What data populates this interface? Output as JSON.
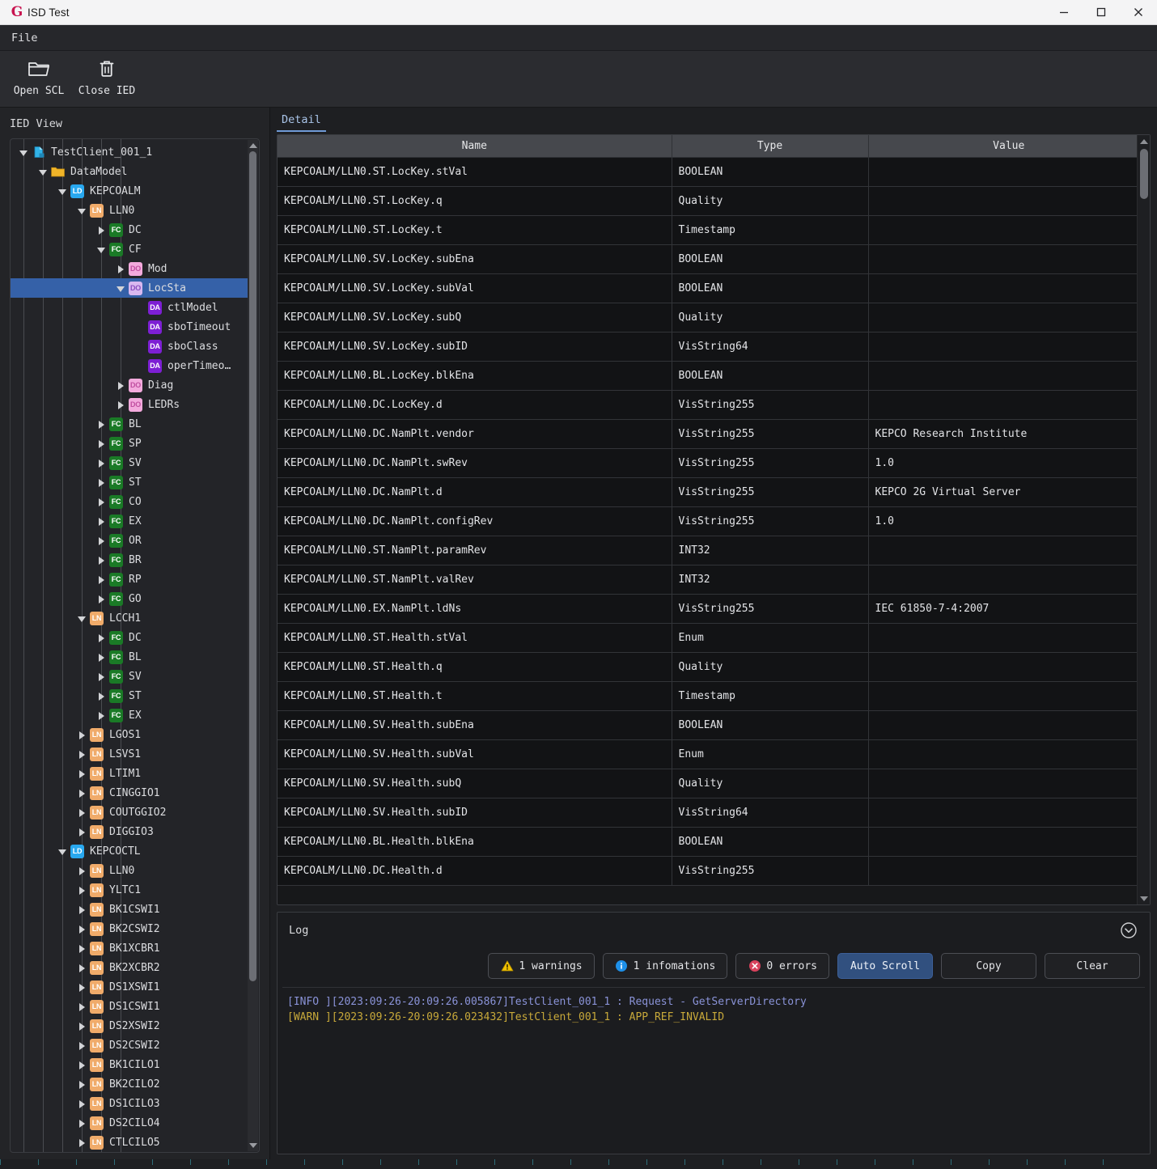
{
  "window": {
    "title": "ISD Test",
    "logo_glyph": "G",
    "minimize": "─",
    "maximize": "□",
    "close": "✕"
  },
  "menubar": {
    "items": [
      {
        "label": "File"
      }
    ]
  },
  "toolbar": {
    "buttons": [
      {
        "label": "Open SCL",
        "icon": "folder-open-icon"
      },
      {
        "label": "Close IED",
        "icon": "trash-icon"
      }
    ]
  },
  "left_pane": {
    "title": "IED View",
    "tree": [
      {
        "depth": 0,
        "arrow": "open",
        "badge": "file",
        "badge_text": "",
        "label": "TestClient_001_1",
        "selected": false
      },
      {
        "depth": 1,
        "arrow": "open",
        "badge": "folder",
        "badge_text": "",
        "label": "DataModel",
        "selected": false
      },
      {
        "depth": 2,
        "arrow": "open",
        "badge": "LD",
        "badge_text": "LD",
        "label": "KEPCOALM",
        "selected": false
      },
      {
        "depth": 3,
        "arrow": "open",
        "badge": "LN",
        "badge_text": "LN",
        "label": "LLN0",
        "selected": false
      },
      {
        "depth": 4,
        "arrow": "closed",
        "badge": "FC",
        "badge_text": "FC",
        "label": "DC",
        "selected": false
      },
      {
        "depth": 4,
        "arrow": "open",
        "badge": "FC",
        "badge_text": "FC",
        "label": "CF",
        "selected": false
      },
      {
        "depth": 5,
        "arrow": "closed",
        "badge": "DO",
        "badge_text": "DO",
        "label": "Mod",
        "selected": false
      },
      {
        "depth": 5,
        "arrow": "open",
        "badge": "DOa",
        "badge_text": "DO",
        "label": "LocSta",
        "selected": true
      },
      {
        "depth": 6,
        "arrow": "none",
        "badge": "DA",
        "badge_text": "DA",
        "label": "ctlModel",
        "selected": false
      },
      {
        "depth": 6,
        "arrow": "none",
        "badge": "DA",
        "badge_text": "DA",
        "label": "sboTimeout",
        "selected": false
      },
      {
        "depth": 6,
        "arrow": "none",
        "badge": "DA",
        "badge_text": "DA",
        "label": "sboClass",
        "selected": false
      },
      {
        "depth": 6,
        "arrow": "none",
        "badge": "DA",
        "badge_text": "DA",
        "label": "operTimeo…",
        "selected": false
      },
      {
        "depth": 5,
        "arrow": "closed",
        "badge": "DO",
        "badge_text": "DO",
        "label": "Diag",
        "selected": false
      },
      {
        "depth": 5,
        "arrow": "closed",
        "badge": "DO",
        "badge_text": "DO",
        "label": "LEDRs",
        "selected": false
      },
      {
        "depth": 4,
        "arrow": "closed",
        "badge": "FC",
        "badge_text": "FC",
        "label": "BL",
        "selected": false
      },
      {
        "depth": 4,
        "arrow": "closed",
        "badge": "FC",
        "badge_text": "FC",
        "label": "SP",
        "selected": false
      },
      {
        "depth": 4,
        "arrow": "closed",
        "badge": "FC",
        "badge_text": "FC",
        "label": "SV",
        "selected": false
      },
      {
        "depth": 4,
        "arrow": "closed",
        "badge": "FC",
        "badge_text": "FC",
        "label": "ST",
        "selected": false
      },
      {
        "depth": 4,
        "arrow": "closed",
        "badge": "FC",
        "badge_text": "FC",
        "label": "CO",
        "selected": false
      },
      {
        "depth": 4,
        "arrow": "closed",
        "badge": "FC",
        "badge_text": "FC",
        "label": "EX",
        "selected": false
      },
      {
        "depth": 4,
        "arrow": "closed",
        "badge": "FC",
        "badge_text": "FC",
        "label": "OR",
        "selected": false
      },
      {
        "depth": 4,
        "arrow": "closed",
        "badge": "FC",
        "badge_text": "FC",
        "label": "BR",
        "selected": false
      },
      {
        "depth": 4,
        "arrow": "closed",
        "badge": "FC",
        "badge_text": "FC",
        "label": "RP",
        "selected": false
      },
      {
        "depth": 4,
        "arrow": "closed",
        "badge": "FC",
        "badge_text": "FC",
        "label": "GO",
        "selected": false
      },
      {
        "depth": 3,
        "arrow": "open",
        "badge": "LN",
        "badge_text": "LN",
        "label": "LCCH1",
        "selected": false
      },
      {
        "depth": 4,
        "arrow": "closed",
        "badge": "FC",
        "badge_text": "FC",
        "label": "DC",
        "selected": false
      },
      {
        "depth": 4,
        "arrow": "closed",
        "badge": "FC",
        "badge_text": "FC",
        "label": "BL",
        "selected": false
      },
      {
        "depth": 4,
        "arrow": "closed",
        "badge": "FC",
        "badge_text": "FC",
        "label": "SV",
        "selected": false
      },
      {
        "depth": 4,
        "arrow": "closed",
        "badge": "FC",
        "badge_text": "FC",
        "label": "ST",
        "selected": false
      },
      {
        "depth": 4,
        "arrow": "closed",
        "badge": "FC",
        "badge_text": "FC",
        "label": "EX",
        "selected": false
      },
      {
        "depth": 3,
        "arrow": "closed",
        "badge": "LN",
        "badge_text": "LN",
        "label": "LGOS1",
        "selected": false
      },
      {
        "depth": 3,
        "arrow": "closed",
        "badge": "LN",
        "badge_text": "LN",
        "label": "LSVS1",
        "selected": false
      },
      {
        "depth": 3,
        "arrow": "closed",
        "badge": "LN",
        "badge_text": "LN",
        "label": "LTIM1",
        "selected": false
      },
      {
        "depth": 3,
        "arrow": "closed",
        "badge": "LN",
        "badge_text": "LN",
        "label": "CINGGIO1",
        "selected": false
      },
      {
        "depth": 3,
        "arrow": "closed",
        "badge": "LN",
        "badge_text": "LN",
        "label": "COUTGGIO2",
        "selected": false
      },
      {
        "depth": 3,
        "arrow": "closed",
        "badge": "LN",
        "badge_text": "LN",
        "label": "DIGGIO3",
        "selected": false
      },
      {
        "depth": 2,
        "arrow": "open",
        "badge": "LD",
        "badge_text": "LD",
        "label": "KEPCOCTL",
        "selected": false
      },
      {
        "depth": 3,
        "arrow": "closed",
        "badge": "LN",
        "badge_text": "LN",
        "label": "LLN0",
        "selected": false
      },
      {
        "depth": 3,
        "arrow": "closed",
        "badge": "LN",
        "badge_text": "LN",
        "label": "YLTC1",
        "selected": false
      },
      {
        "depth": 3,
        "arrow": "closed",
        "badge": "LN",
        "badge_text": "LN",
        "label": "BK1CSWI1",
        "selected": false
      },
      {
        "depth": 3,
        "arrow": "closed",
        "badge": "LN",
        "badge_text": "LN",
        "label": "BK2CSWI2",
        "selected": false
      },
      {
        "depth": 3,
        "arrow": "closed",
        "badge": "LN",
        "badge_text": "LN",
        "label": "BK1XCBR1",
        "selected": false
      },
      {
        "depth": 3,
        "arrow": "closed",
        "badge": "LN",
        "badge_text": "LN",
        "label": "BK2XCBR2",
        "selected": false
      },
      {
        "depth": 3,
        "arrow": "closed",
        "badge": "LN",
        "badge_text": "LN",
        "label": "DS1XSWI1",
        "selected": false
      },
      {
        "depth": 3,
        "arrow": "closed",
        "badge": "LN",
        "badge_text": "LN",
        "label": "DS1CSWI1",
        "selected": false
      },
      {
        "depth": 3,
        "arrow": "closed",
        "badge": "LN",
        "badge_text": "LN",
        "label": "DS2XSWI2",
        "selected": false
      },
      {
        "depth": 3,
        "arrow": "closed",
        "badge": "LN",
        "badge_text": "LN",
        "label": "DS2CSWI2",
        "selected": false
      },
      {
        "depth": 3,
        "arrow": "closed",
        "badge": "LN",
        "badge_text": "LN",
        "label": "BK1CILO1",
        "selected": false
      },
      {
        "depth": 3,
        "arrow": "closed",
        "badge": "LN",
        "badge_text": "LN",
        "label": "BK2CILO2",
        "selected": false
      },
      {
        "depth": 3,
        "arrow": "closed",
        "badge": "LN",
        "badge_text": "LN",
        "label": "DS1CILO3",
        "selected": false
      },
      {
        "depth": 3,
        "arrow": "closed",
        "badge": "LN",
        "badge_text": "LN",
        "label": "DS2CILO4",
        "selected": false
      },
      {
        "depth": 3,
        "arrow": "closed",
        "badge": "LN",
        "badge_text": "LN",
        "label": "CTLCILO5",
        "selected": false
      }
    ]
  },
  "detail": {
    "tab_label": "Detail",
    "columns": [
      "Name",
      "Type",
      "Value"
    ],
    "rows": [
      {
        "name": "KEPCOALM/LLN0.ST.LocKey.stVal",
        "type": "BOOLEAN",
        "value": ""
      },
      {
        "name": "KEPCOALM/LLN0.ST.LocKey.q",
        "type": "Quality",
        "value": ""
      },
      {
        "name": "KEPCOALM/LLN0.ST.LocKey.t",
        "type": "Timestamp",
        "value": ""
      },
      {
        "name": "KEPCOALM/LLN0.SV.LocKey.subEna",
        "type": "BOOLEAN",
        "value": ""
      },
      {
        "name": "KEPCOALM/LLN0.SV.LocKey.subVal",
        "type": "BOOLEAN",
        "value": ""
      },
      {
        "name": "KEPCOALM/LLN0.SV.LocKey.subQ",
        "type": "Quality",
        "value": ""
      },
      {
        "name": "KEPCOALM/LLN0.SV.LocKey.subID",
        "type": "VisString64",
        "value": ""
      },
      {
        "name": "KEPCOALM/LLN0.BL.LocKey.blkEna",
        "type": "BOOLEAN",
        "value": ""
      },
      {
        "name": "KEPCOALM/LLN0.DC.LocKey.d",
        "type": "VisString255",
        "value": ""
      },
      {
        "name": "KEPCOALM/LLN0.DC.NamPlt.vendor",
        "type": "VisString255",
        "value": "KEPCO Research Institute"
      },
      {
        "name": "KEPCOALM/LLN0.DC.NamPlt.swRev",
        "type": "VisString255",
        "value": "1.0"
      },
      {
        "name": "KEPCOALM/LLN0.DC.NamPlt.d",
        "type": "VisString255",
        "value": "KEPCO 2G Virtual Server"
      },
      {
        "name": "KEPCOALM/LLN0.DC.NamPlt.configRev",
        "type": "VisString255",
        "value": "1.0"
      },
      {
        "name": "KEPCOALM/LLN0.ST.NamPlt.paramRev",
        "type": "INT32",
        "value": ""
      },
      {
        "name": "KEPCOALM/LLN0.ST.NamPlt.valRev",
        "type": "INT32",
        "value": ""
      },
      {
        "name": "KEPCOALM/LLN0.EX.NamPlt.ldNs",
        "type": "VisString255",
        "value": "IEC 61850-7-4:2007"
      },
      {
        "name": "KEPCOALM/LLN0.ST.Health.stVal",
        "type": "Enum",
        "value": ""
      },
      {
        "name": "KEPCOALM/LLN0.ST.Health.q",
        "type": "Quality",
        "value": ""
      },
      {
        "name": "KEPCOALM/LLN0.ST.Health.t",
        "type": "Timestamp",
        "value": ""
      },
      {
        "name": "KEPCOALM/LLN0.SV.Health.subEna",
        "type": "BOOLEAN",
        "value": ""
      },
      {
        "name": "KEPCOALM/LLN0.SV.Health.subVal",
        "type": "Enum",
        "value": ""
      },
      {
        "name": "KEPCOALM/LLN0.SV.Health.subQ",
        "type": "Quality",
        "value": ""
      },
      {
        "name": "KEPCOALM/LLN0.SV.Health.subID",
        "type": "VisString64",
        "value": ""
      },
      {
        "name": "KEPCOALM/LLN0.BL.Health.blkEna",
        "type": "BOOLEAN",
        "value": ""
      },
      {
        "name": "KEPCOALM/LLN0.DC.Health.d",
        "type": "VisString255",
        "value": ""
      }
    ]
  },
  "log": {
    "title": "Log",
    "collapse_icon": "chevron-down-circle-icon",
    "warnings_label": "1 warnings",
    "informations_label": "1 infomations",
    "errors_label": "0 errors",
    "auto_scroll_label": "Auto Scroll",
    "copy_label": "Copy",
    "clear_label": "Clear",
    "lines": [
      {
        "level": "INFO",
        "text": "[INFO ][2023:09:26-20:09:26.005867]TestClient_001_1 : Request - GetServerDirectory"
      },
      {
        "level": "WARN",
        "text": "[WARN ][2023:09:26-20:09:26.023432]TestClient_001_1 : APP_REF_INVALID"
      }
    ]
  },
  "colors": {
    "accent_blue": "#3561a8",
    "active_button": "#31507f",
    "badge_ld": "#29a8ef",
    "badge_ln": "#f0ab6a",
    "badge_fc": "#1a7a26",
    "badge_do": "#f3aadd",
    "badge_da": "#7d1fd4",
    "log_info": "#8a93d8",
    "log_warn": "#c8a93a",
    "warning_icon": "#f2c200",
    "info_icon": "#1e90e8",
    "error_icon": "#d8425c"
  }
}
